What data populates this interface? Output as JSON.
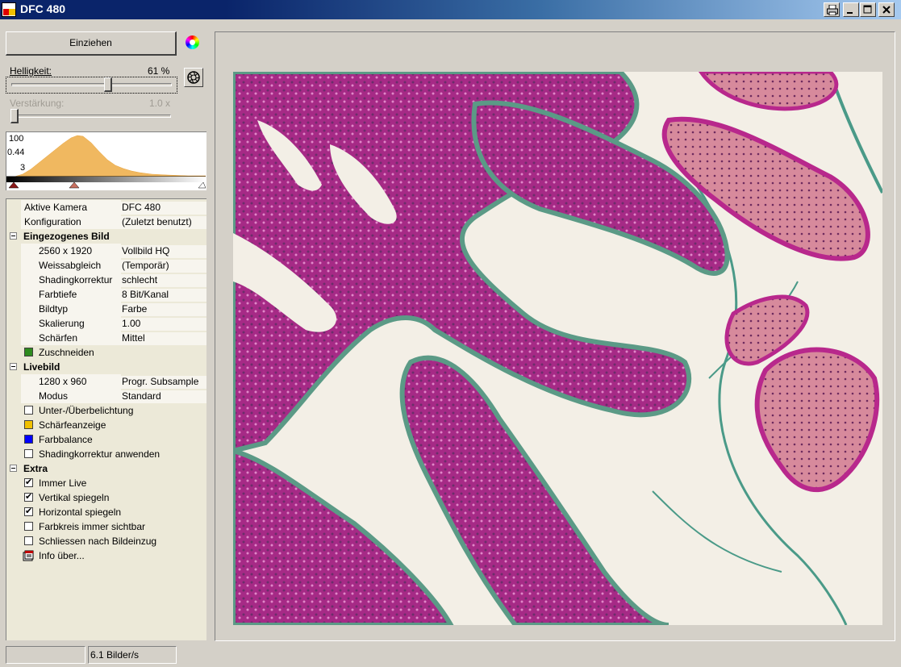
{
  "window": {
    "title": "DFC 480"
  },
  "capture": {
    "button_label": "Einziehen"
  },
  "brightness": {
    "label": "Helligkeit:",
    "value": "61 %",
    "fraction": 0.61
  },
  "gain": {
    "label": "Verstärkung:",
    "value": "1.0 x",
    "fraction": 0.0
  },
  "histogram": {
    "label_top": "100",
    "label_mid": "0.44",
    "label_low": "3"
  },
  "properties": {
    "active_camera": {
      "key": "Aktive Kamera",
      "value": "DFC 480"
    },
    "configuration": {
      "key": "Konfiguration",
      "value": "(Zuletzt benutzt)"
    },
    "captured_image": {
      "title": "Eingezogenes Bild",
      "rows": [
        {
          "key": "2560 x 1920",
          "value": "Vollbild HQ"
        },
        {
          "key": "Weissabgleich",
          "value": "(Temporär)"
        },
        {
          "key": "Shadingkorrektur",
          "value": "schlecht"
        },
        {
          "key": "Farbtiefe",
          "value": "8 Bit/Kanal"
        },
        {
          "key": "Bildtyp",
          "value": "Farbe"
        },
        {
          "key": "Skalierung",
          "value": "1.00"
        },
        {
          "key": "Schärfen",
          "value": "Mittel"
        }
      ],
      "crop_label": "Zuschneiden",
      "crop_color": "#2e8b1e"
    },
    "live_image": {
      "title": "Livebild",
      "rows": [
        {
          "key": "1280 x 960",
          "value": "Progr. Subsample"
        },
        {
          "key": "Modus",
          "value": "Standard"
        }
      ],
      "exposure_label": "Unter-/Überbelichtung",
      "sharpness_label": "Schärfeanzeige",
      "sharpness_color": "#f0c000",
      "color_balance_label": "Farbbalance",
      "color_balance_color": "#0000ff",
      "shading_label": "Shadingkorrektur anwenden"
    },
    "extra": {
      "title": "Extra",
      "options": [
        {
          "label": "Immer Live",
          "checked": true
        },
        {
          "label": "Vertikal spiegeln",
          "checked": true
        },
        {
          "label": "Horizontal spiegeln",
          "checked": true
        },
        {
          "label": "Farbkreis immer sichtbar",
          "checked": false
        },
        {
          "label": "Schliessen nach Bildeinzug",
          "checked": false
        }
      ],
      "info_label": "Info über..."
    }
  },
  "status": {
    "left": "",
    "fps": "6.1 Bilder/s"
  },
  "icons": [
    "app-icon",
    "print-icon",
    "minimize-icon",
    "maximize-icon",
    "close-icon",
    "color-wheel-icon",
    "aperture-icon",
    "info-icon"
  ]
}
